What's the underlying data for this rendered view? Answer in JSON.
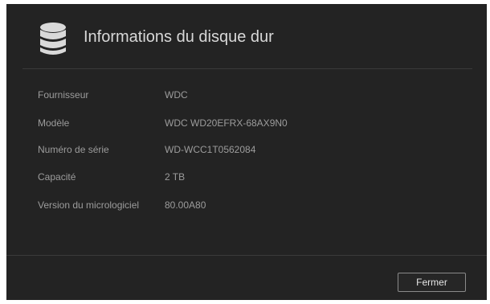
{
  "dialog": {
    "title": "Informations du disque dur",
    "icon": "database-icon",
    "close_label": "Fermer"
  },
  "info": [
    {
      "label": "Fournisseur",
      "value": "WDC"
    },
    {
      "label": "Modèle",
      "value": "WDC WD20EFRX-68AX9N0"
    },
    {
      "label": "Numéro de série",
      "value": "WD-WCC1T0562084"
    },
    {
      "label": "Capacité",
      "value": "2 TB"
    },
    {
      "label": "Version du micrologiciel",
      "value": "80.00A80"
    }
  ],
  "colors": {
    "dialog_bg": "#232323",
    "title_text": "#d8d8d8",
    "body_text": "#9c9c9c",
    "icon": "#d9d9d9"
  }
}
